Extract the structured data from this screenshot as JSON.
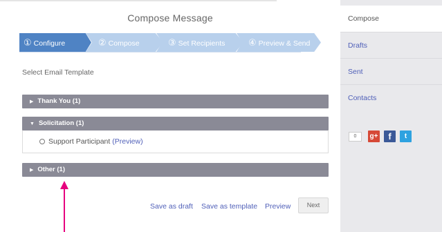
{
  "page": {
    "title": "Compose Message"
  },
  "wizard": {
    "steps": [
      {
        "num": "①",
        "label": "Configure",
        "active": true
      },
      {
        "num": "②",
        "label": "Compose",
        "active": false
      },
      {
        "num": "③",
        "label": "Set Recipients",
        "active": false
      },
      {
        "num": "④",
        "label": "Preview & Send",
        "active": false
      }
    ]
  },
  "template_section": {
    "label": "Select Email Template",
    "groups": [
      {
        "title": "Thank You (1)",
        "expanded": false
      },
      {
        "title": "Solicitation (1)",
        "expanded": true,
        "options": [
          {
            "label": "Support Participant",
            "preview_label": "(Preview)"
          }
        ]
      },
      {
        "title": "Other (1)",
        "expanded": false
      }
    ]
  },
  "actions": {
    "save_draft": "Save as draft",
    "save_template": "Save as template",
    "preview": "Preview",
    "next": "Next"
  },
  "sidebar": {
    "items": [
      {
        "label": "Compose",
        "active": true
      },
      {
        "label": "Drafts",
        "active": false
      },
      {
        "label": "Sent",
        "active": false
      },
      {
        "label": "Contacts",
        "active": false
      }
    ]
  },
  "social": {
    "count": "0",
    "icons": [
      "google-plus-icon",
      "facebook-icon",
      "twitter-icon"
    ]
  },
  "colors": {
    "accent": "#4f83c4",
    "step_inactive": "#b8d0ec",
    "accordion": "#8a8a96",
    "link": "#4f5fb8",
    "annotation_arrow": "#e6007e"
  }
}
